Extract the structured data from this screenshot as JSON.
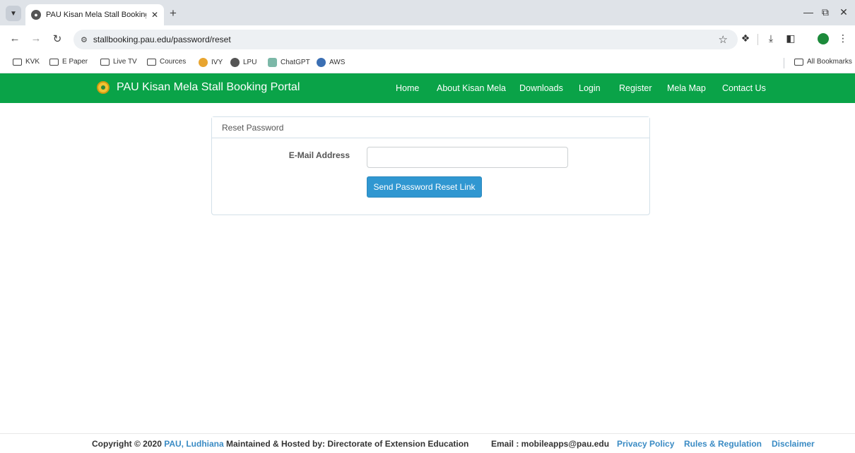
{
  "browser": {
    "tab_title": "PAU Kisan Mela Stall Booking Port",
    "url": "stallbooking.pau.edu/password/reset",
    "bookmarks": [
      "KVK",
      "E Paper",
      "Live TV",
      "Cources",
      "IVY",
      "LPU",
      "ChatGPT",
      "AWS"
    ],
    "all_bookmarks": "All Bookmarks"
  },
  "navbar": {
    "brand": "PAU Kisan Mela Stall Booking Portal",
    "links": [
      "Home",
      "About Kisan Mela",
      "Downloads",
      "Login",
      "Register",
      "Mela Map",
      "Contact Us"
    ],
    "color": "#0aa348"
  },
  "panel": {
    "heading": "Reset Password",
    "email_label": "E-Mail Address",
    "email_value": "",
    "submit_label": "Send Password Reset Link",
    "button_color": "#3097d1"
  },
  "footer": {
    "copyright": "Copyright © 2020",
    "org_link": "PAU, Ludhiana",
    "maintained": "Maintained & Hosted by: Directorate of Extension Education",
    "email": "Email : mobileapps@pau.edu",
    "privacy": "Privacy Policy",
    "rules": "Rules & Regulation",
    "disclaimer": "Disclaimer"
  }
}
